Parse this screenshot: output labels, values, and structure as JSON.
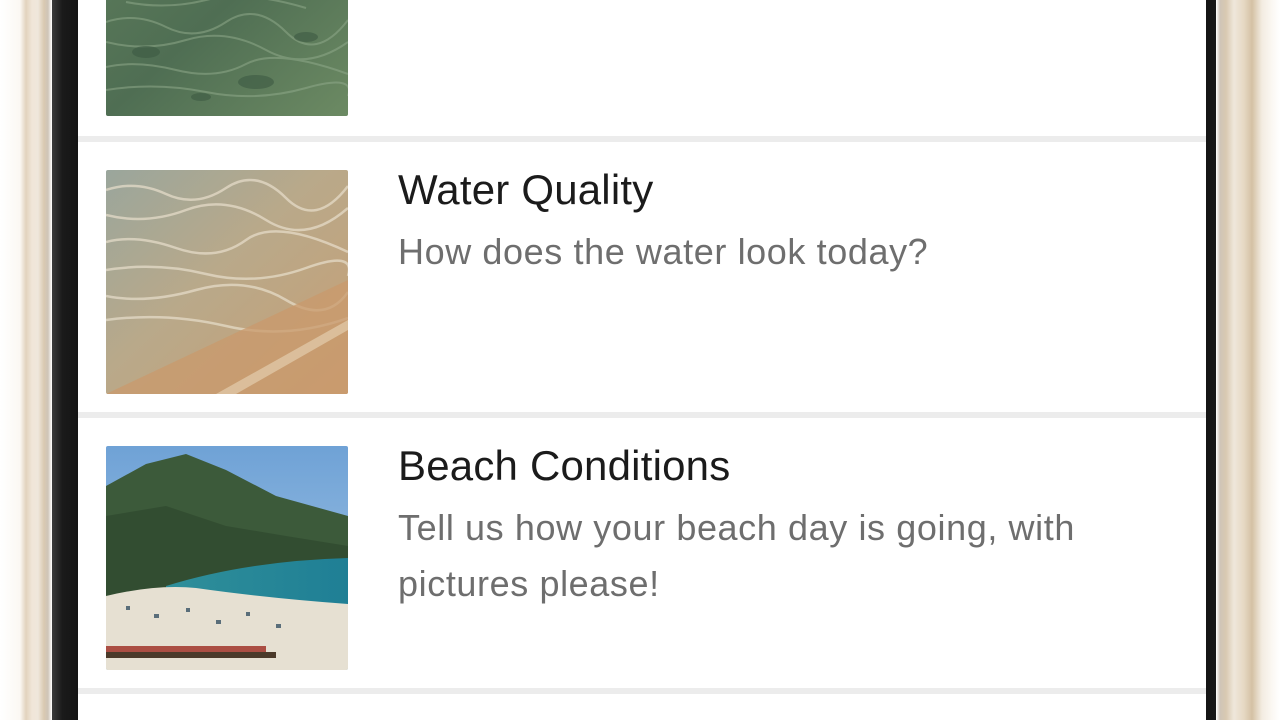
{
  "list": {
    "items": [
      {
        "title": "",
        "subtitle": "",
        "image": "sea-floor-photo"
      },
      {
        "title": "Water Quality",
        "subtitle": "How does the water look today?",
        "image": "shoreline-water-photo"
      },
      {
        "title": "Beach Conditions",
        "subtitle": "Tell us how your beach day is going, with pictures please!",
        "image": "beach-photo"
      }
    ]
  },
  "colors": {
    "title": "#1b1b1b",
    "subtitle": "#6e6e6e",
    "divider": "#ececec",
    "bezel": "#1a1a1a",
    "frame_gold": "#e2d3bd"
  }
}
